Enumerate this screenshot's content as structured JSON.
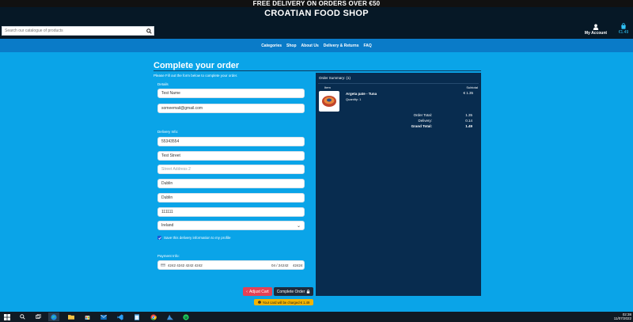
{
  "banner": "FREE DELIVERY ON ORDERS OVER €50",
  "shop_title": "CROATIAN FOOD SHOP",
  "search": {
    "placeholder": "Search our catalogue of products"
  },
  "account": {
    "label": "My Account"
  },
  "cart": {
    "amount": "€1.49"
  },
  "nav": [
    "Categories",
    "Shop",
    "About Us",
    "Delivery & Returns",
    "FAQ"
  ],
  "page": {
    "title": "Complete your order",
    "intro": "Please Fill out the form below to complete your order."
  },
  "form": {
    "details_label": "Details",
    "name_value": "Test Name",
    "email_value": "someemail@gmail.com",
    "delivery_label": "Delivery Info:",
    "phone_value": "55343554",
    "street1_value": "Test Street",
    "street2_placeholder": "Street Address 2",
    "town_value": "Dublin",
    "county_value": "Dublin",
    "postcode_value": "111111",
    "country_value": "Ireland",
    "save_info_label": "Save this delivery information to my profile",
    "save_info_checked": true,
    "payment_label": "Payment Info:",
    "card_number": "4242 4242 4242 4242",
    "card_expiry": "04 / 24",
    "card_cvc": "242",
    "card_zip": "42424"
  },
  "summary": {
    "title": "Order Summary: (1)",
    "col_item": "Item",
    "col_subtotal": "Subtotal",
    "product": {
      "name": "Argeta pate - Tuna",
      "quantity": "Quantity: 1",
      "price": "€ 1.35",
      "image_icon": "product-tin-icon"
    },
    "order_total_label": "Order Total:",
    "order_total_value": "1.35",
    "delivery_label": "Delivery:",
    "delivery_value": "0.14",
    "grand_total_label": "Grand Total:",
    "grand_total_value": "1.49"
  },
  "buttons": {
    "adjust_cart": "Adjust Cart",
    "complete_order": "Complete Order",
    "charge_notice": "Your card will be charged € 1.49"
  },
  "taskbar": {
    "time": "02:38",
    "date": "11/07/2022"
  },
  "colors": {
    "page_bg": "#0aa4e8",
    "header_bg": "#061826",
    "nav_bg": "#0a7bc8",
    "summary_bg": "#082c4f",
    "adjust_btn": "#e64155",
    "complete_btn": "#1e2b3c",
    "notice": "#f4b400"
  }
}
